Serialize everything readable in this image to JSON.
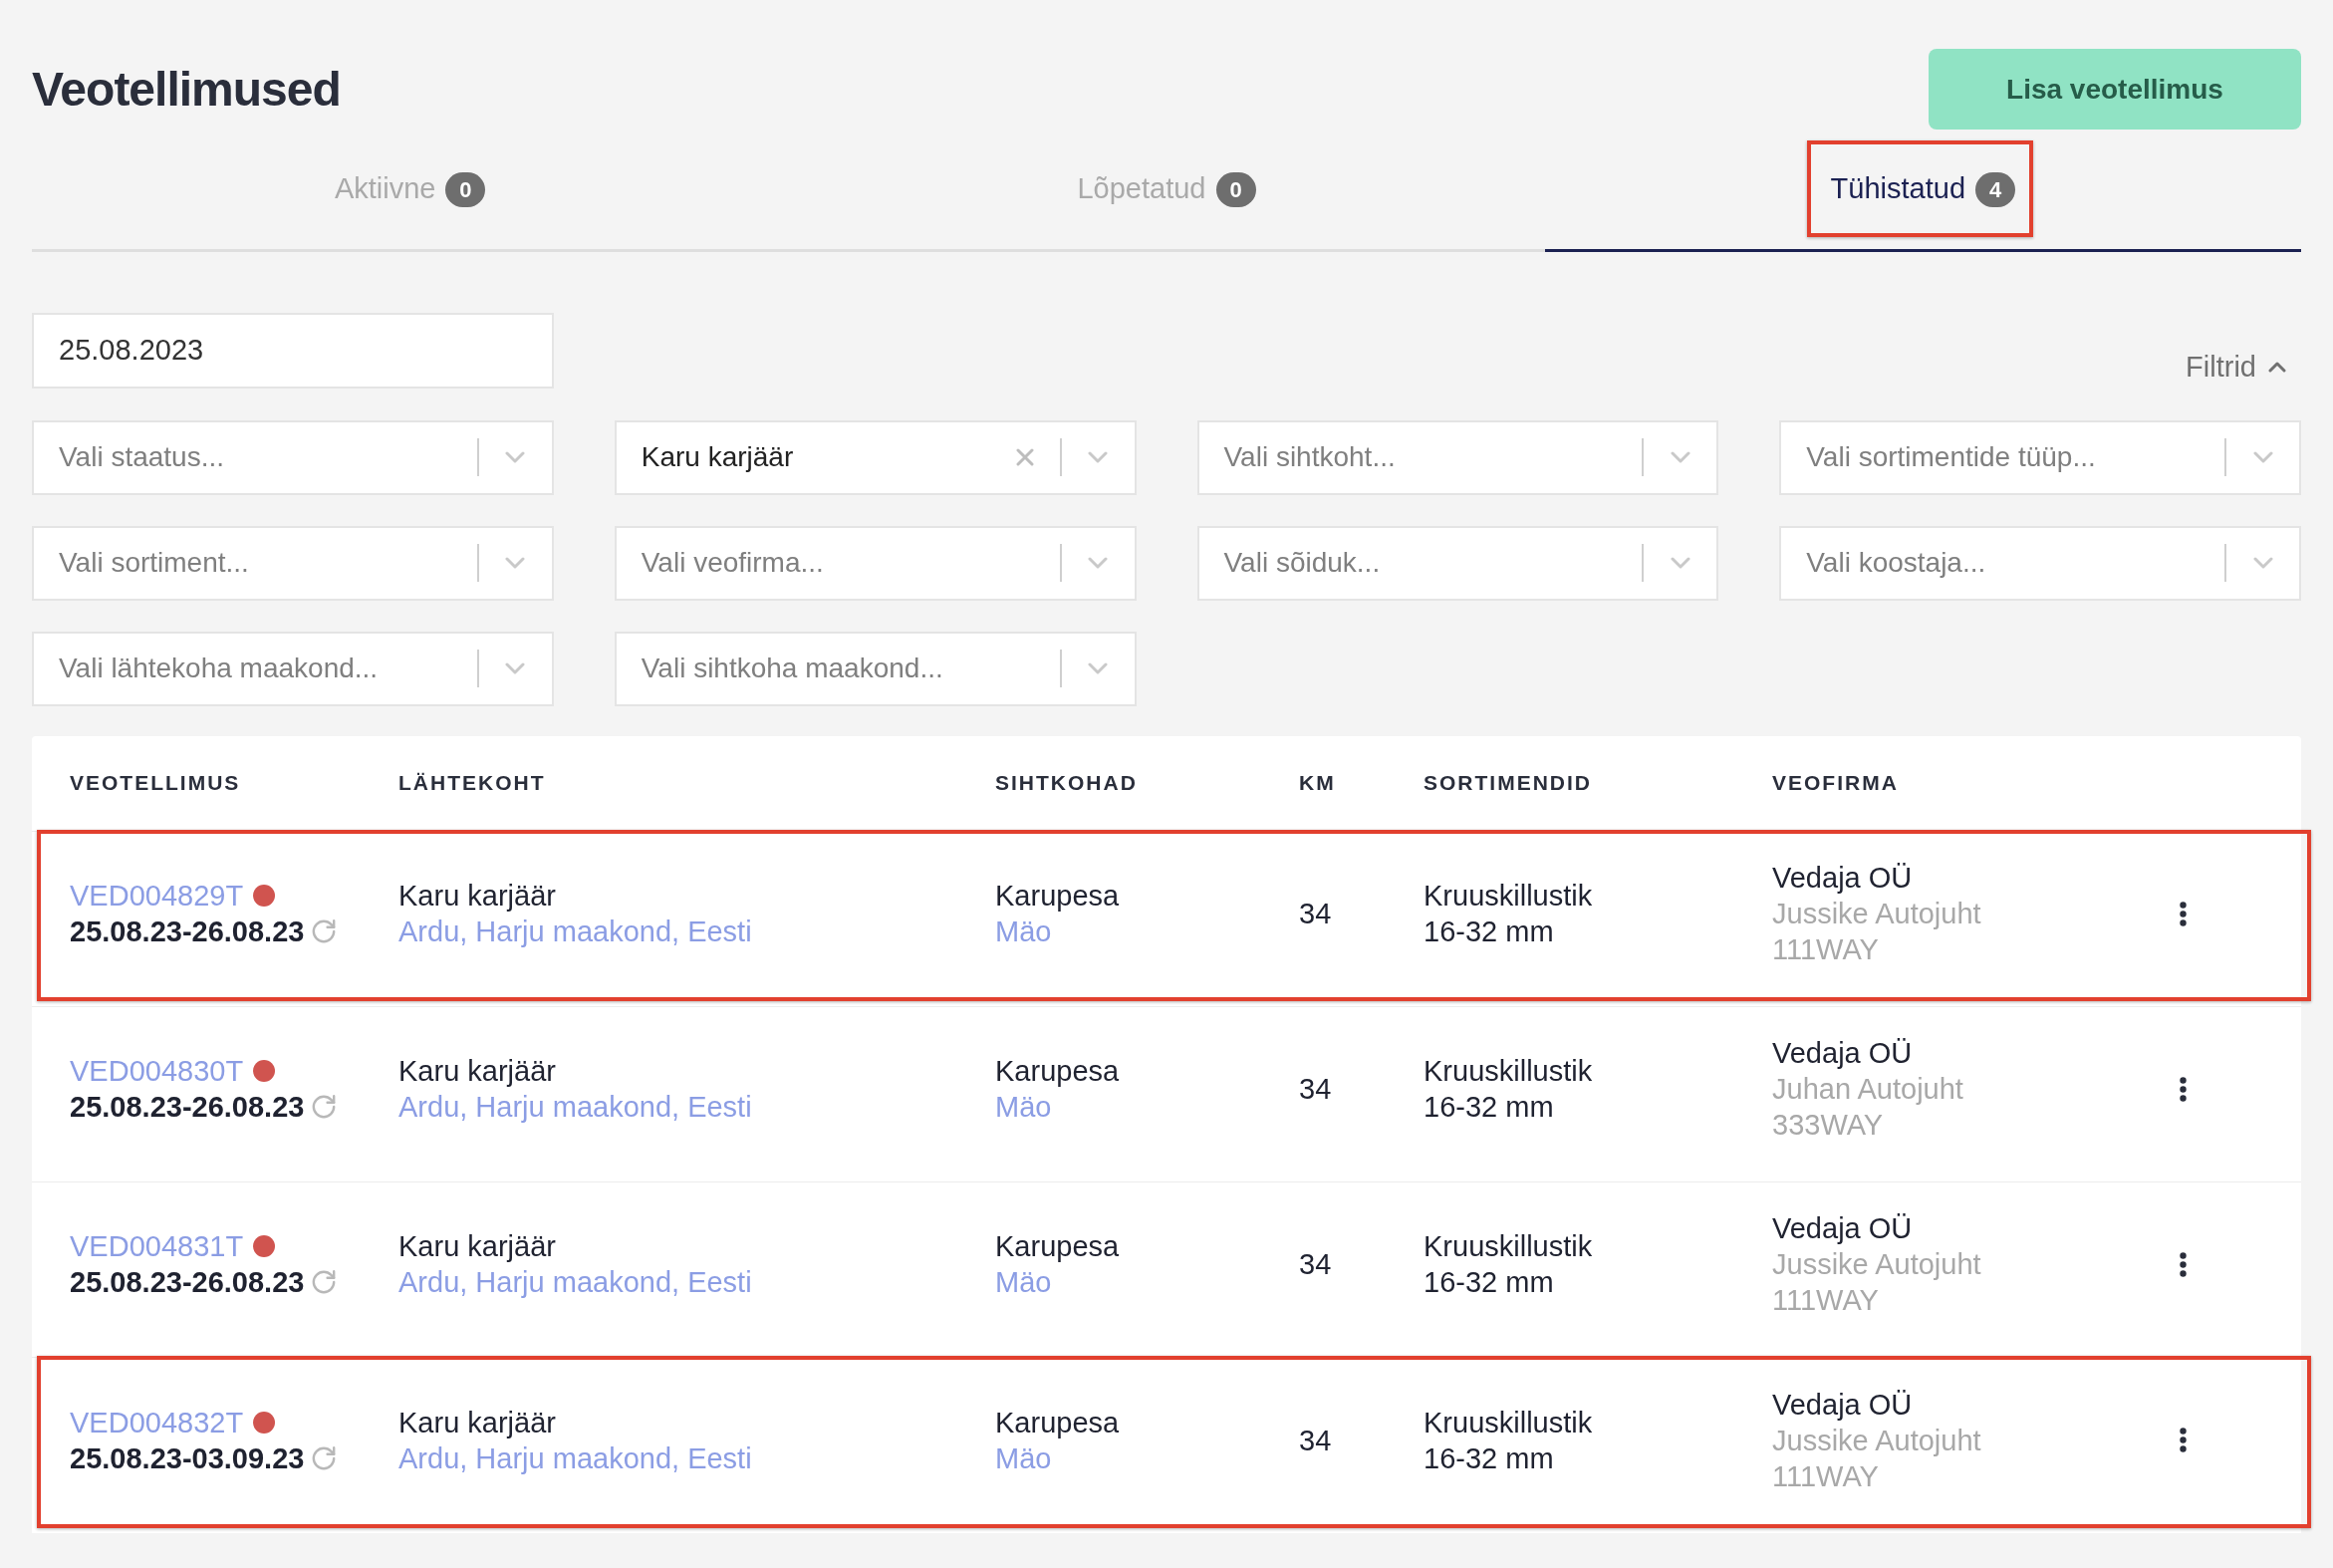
{
  "page_title": "Veotellimused",
  "add_button": {
    "label": "Lisa veotellimus"
  },
  "tabs": [
    {
      "label": "Aktiivne",
      "count": "0",
      "selected": false,
      "highlighted": false
    },
    {
      "label": "Lõpetatud",
      "count": "0",
      "selected": false,
      "highlighted": false
    },
    {
      "label": "Tühistatud",
      "count": "4",
      "selected": true,
      "highlighted": true
    }
  ],
  "date_field": {
    "value": "25.08.2023"
  },
  "filters_toggle": {
    "label": "Filtrid",
    "expanded": true
  },
  "filters": [
    {
      "placeholder": "Vali staatus..."
    },
    {
      "value": "Karu karjäär"
    },
    {
      "placeholder": "Vali sihtkoht..."
    },
    {
      "placeholder": "Vali sortimentide tüüp..."
    },
    {
      "placeholder": "Vali sortiment..."
    },
    {
      "placeholder": "Vali veofirma..."
    },
    {
      "placeholder": "Vali sõiduk..."
    },
    {
      "placeholder": "Vali koostaja..."
    },
    {
      "placeholder": "Vali lähtekoha maakond..."
    },
    {
      "placeholder": "Vali sihtkoha maakond..."
    }
  ],
  "table": {
    "columns": [
      "VEOTELLIMUS",
      "LÄHTEKOHT",
      "SIHTKOHAD",
      "KM",
      "SORTIMENDID",
      "VEOFIRMA"
    ],
    "rows": [
      {
        "order_id": "VED004829T",
        "color": "#d0544f",
        "dates": "25.08.23-26.08.23",
        "origin_name": "Karu karjäär",
        "origin_address": "Ardu, Harju maakond, Eesti",
        "destination_name": "Karupesa",
        "destination_place": "Mäo",
        "km": "34",
        "assortment": "Kruuskillustik",
        "fraction": "16-32 mm",
        "carrier": "Vedaja OÜ",
        "driver": "Jussike Autojuht",
        "vehicle": "111WAY",
        "highlighted": true
      },
      {
        "order_id": "VED004830T",
        "color": "#d0544f",
        "dates": "25.08.23-26.08.23",
        "origin_name": "Karu karjäär",
        "origin_address": "Ardu, Harju maakond, Eesti",
        "destination_name": "Karupesa",
        "destination_place": "Mäo",
        "km": "34",
        "assortment": "Kruuskillustik",
        "fraction": "16-32 mm",
        "carrier": "Vedaja OÜ",
        "driver": "Juhan Autojuht",
        "vehicle": "333WAY",
        "highlighted": false
      },
      {
        "order_id": "VED004831T",
        "color": "#d0544f",
        "dates": "25.08.23-26.08.23",
        "origin_name": "Karu karjäär",
        "origin_address": "Ardu, Harju maakond, Eesti",
        "destination_name": "Karupesa",
        "destination_place": "Mäo",
        "km": "34",
        "assortment": "Kruuskillustik",
        "fraction": "16-32 mm",
        "carrier": "Vedaja OÜ",
        "driver": "Jussike Autojuht",
        "vehicle": "111WAY",
        "highlighted": false
      },
      {
        "order_id": "VED004832T",
        "color": "#d0544f",
        "dates": "25.08.23-03.09.23",
        "origin_name": "Karu karjäär",
        "origin_address": "Ardu, Harju maakond, Eesti",
        "destination_name": "Karupesa",
        "destination_place": "Mäo",
        "km": "34",
        "assortment": "Kruuskillustik",
        "fraction": "16-32 mm",
        "carrier": "Vedaja OÜ",
        "driver": "Jussike Autojuht",
        "vehicle": "111WAY",
        "highlighted": true
      }
    ]
  }
}
